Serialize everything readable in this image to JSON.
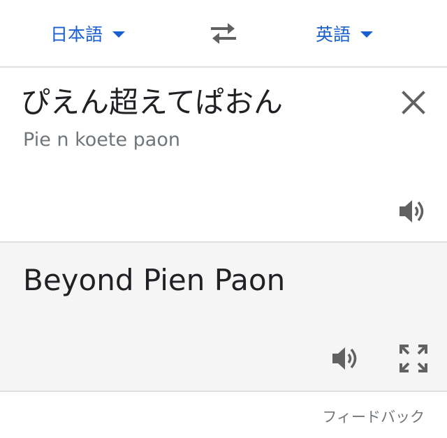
{
  "header": {
    "source_language": "日本語",
    "target_language": "英語",
    "swap_icon": "swap-arrows-icon",
    "dropdown_icon": "caret-down-icon"
  },
  "source": {
    "text": "ぴえん超えてぱおん",
    "transliteration": "Pie n koete paon",
    "clear_icon": "close-icon",
    "speaker_icon": "speaker-icon"
  },
  "target": {
    "text": "Beyond Pien Paon",
    "speaker_icon": "speaker-icon",
    "expand_icon": "fullscreen-icon"
  },
  "footer": {
    "feedback_label": "フィードバック"
  },
  "colors": {
    "accent": "#1a5fd0",
    "text": "#202124",
    "secondary_text": "#70757a",
    "icon": "#616161",
    "panel_background": "#f5f5f5",
    "divider": "#e0e0e0"
  }
}
